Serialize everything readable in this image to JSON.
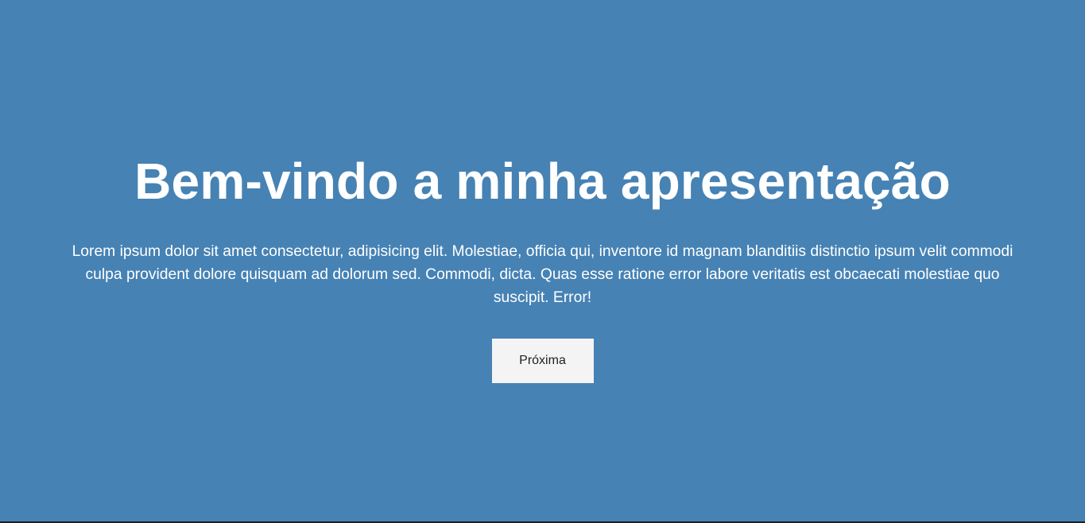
{
  "slide": {
    "title": "Bem-vindo a minha apresentação",
    "body": "Lorem ipsum dolor sit amet consectetur, adipisicing elit. Molestiae, officia qui, inventore id magnam blanditiis distinctio ipsum velit commodi culpa provident dolore quisquam ad dolorum sed. Commodi, dicta. Quas esse ratione error labore veritatis est obcaecati molestiae quo suscipit. Error!",
    "next_label": "Próxima"
  },
  "colors": {
    "background": "#4682b4",
    "text": "#ffffff",
    "button_background": "#f4f4f4",
    "button_text": "#222222"
  }
}
